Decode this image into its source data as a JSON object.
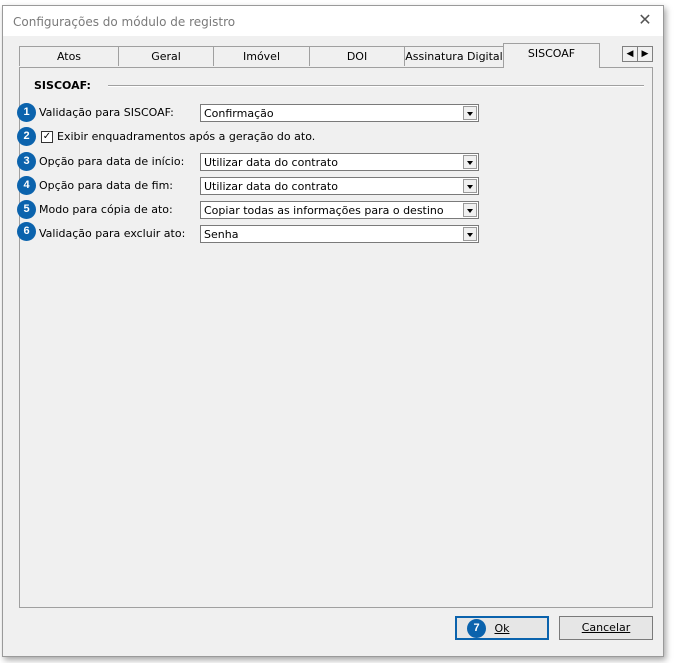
{
  "window": {
    "title": "Configurações do módulo de registro"
  },
  "tabs": [
    "Atos",
    "Geral",
    "Imóvel",
    "DOI",
    "Assinatura Digital",
    "SISCOAF"
  ],
  "active_tab": "SISCOAF",
  "section": {
    "title": "SISCOAF:"
  },
  "fields": [
    {
      "badge": "1",
      "label": "Validação para SISCOAF:",
      "value": "Confirmação"
    },
    {
      "badge": "3",
      "label": "Opção para data de início:",
      "value": "Utilizar data do contrato"
    },
    {
      "badge": "4",
      "label": "Opção para data de fim:",
      "value": "Utilizar data do contrato"
    },
    {
      "badge": "5",
      "label": "Modo para cópia de ato:",
      "value": "Copiar todas as informações para o destino"
    },
    {
      "badge": "6",
      "label": "Validação para excluir ato:",
      "value": "Senha"
    }
  ],
  "checkbox": {
    "badge": "2",
    "label": "Exibir enquadramentos após a geração do ato.",
    "checked": true,
    "mark": "✓"
  },
  "buttons": {
    "ok_badge": "7",
    "ok_label": "Ok",
    "cancel_label": "Cancelar"
  },
  "icons": {
    "close": "✕",
    "scroll_left": "◀",
    "scroll_right": "▶"
  },
  "colors": {
    "badge": "#0b63ad",
    "window_bg": "#f0f0f0"
  }
}
